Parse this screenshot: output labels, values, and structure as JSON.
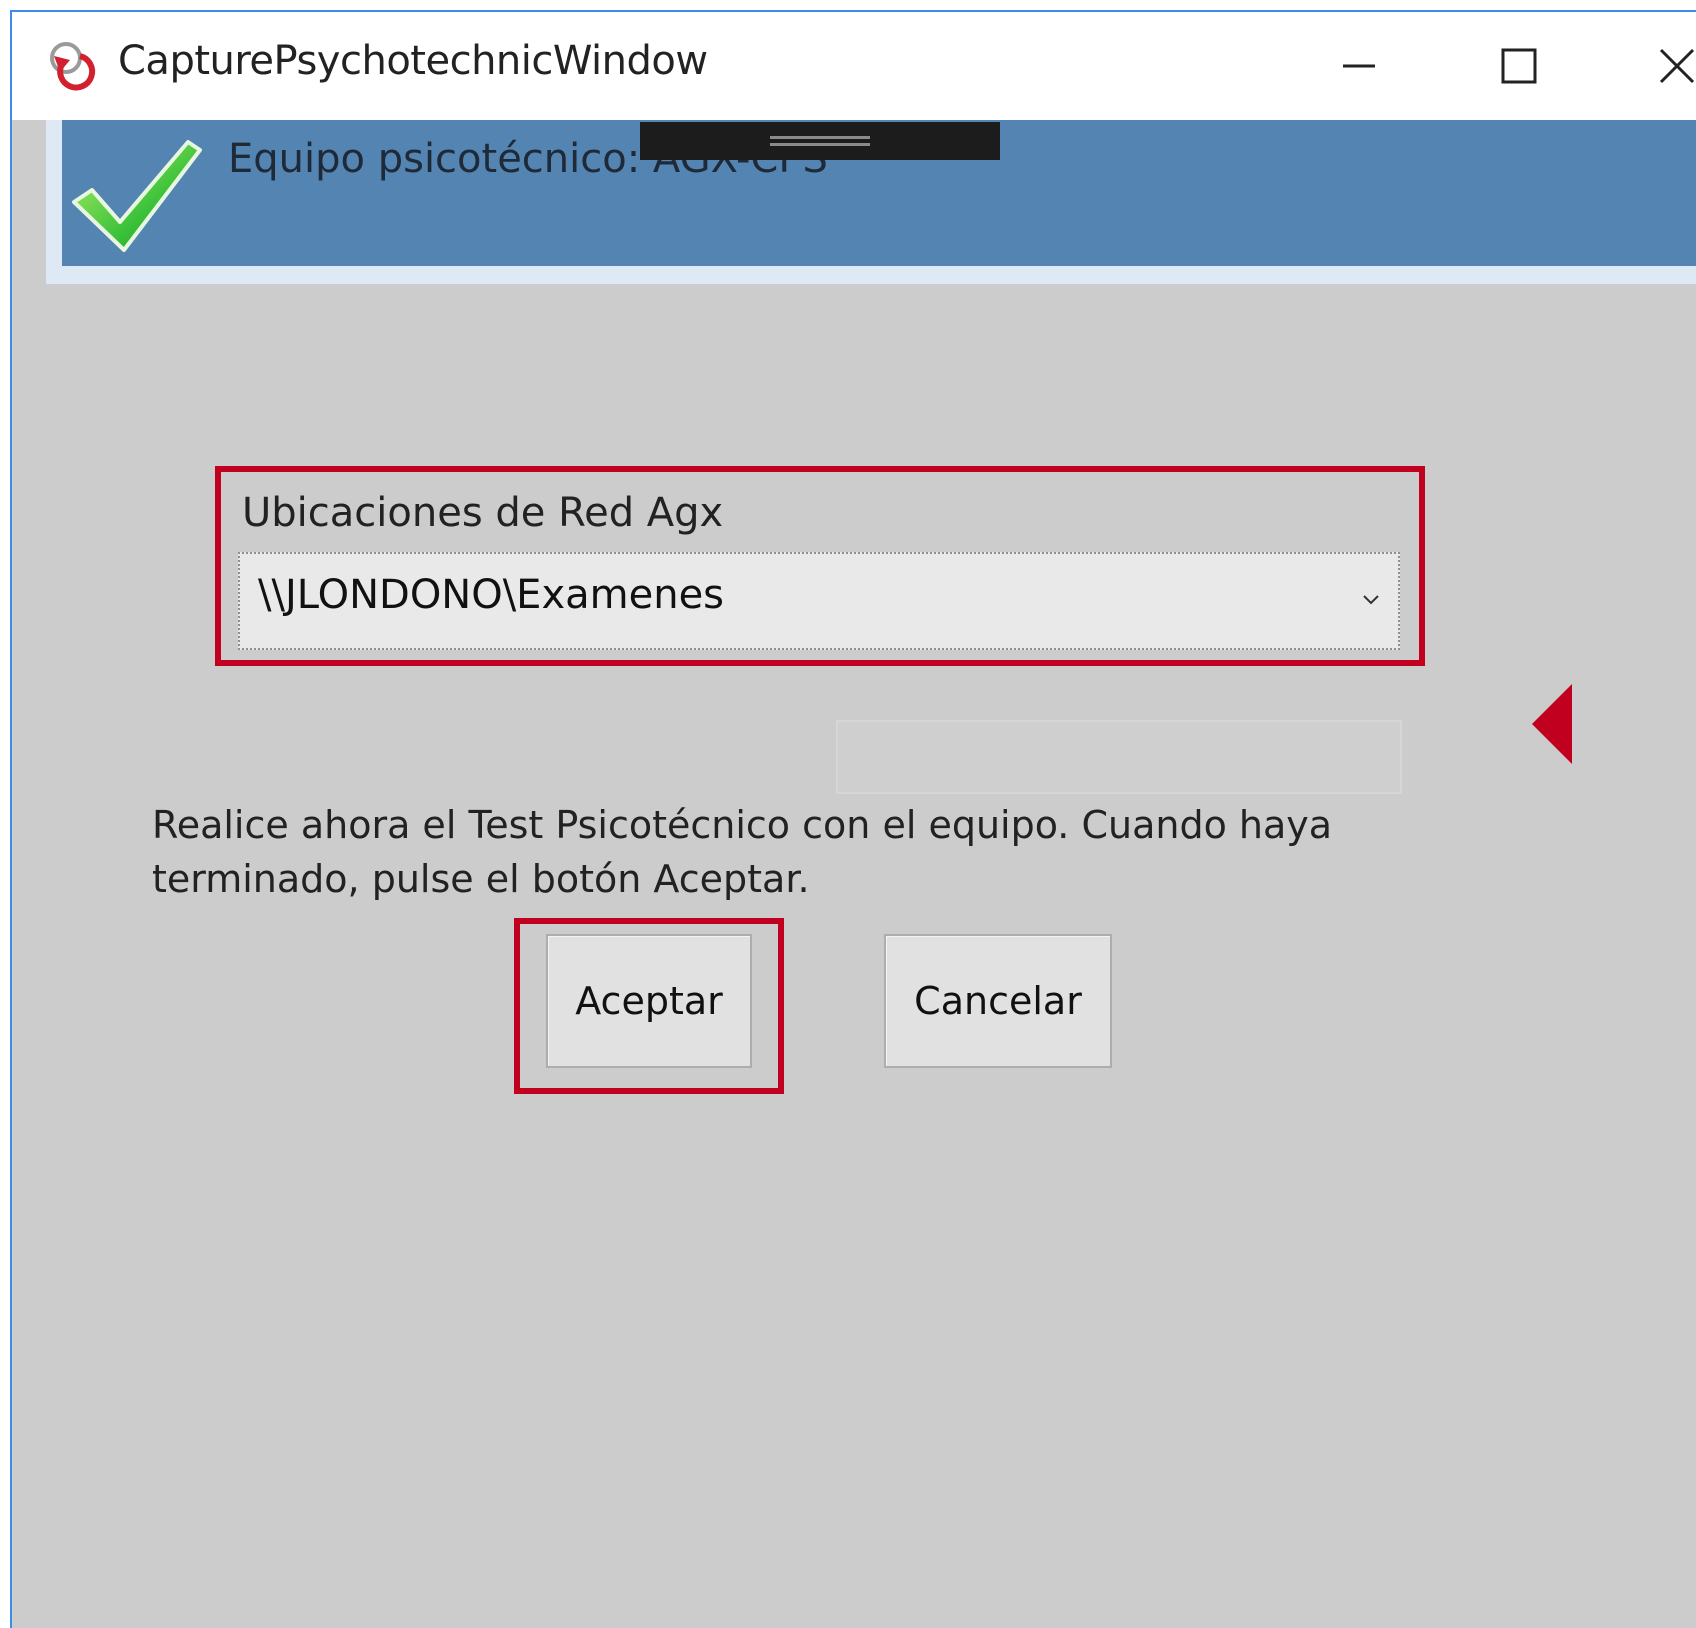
{
  "window": {
    "title": "CapturePsychotechnicWindow",
    "app_icon": "refresh-arrow-icon",
    "controls": {
      "minimize_icon": "minimize-icon",
      "maximize_icon": "maximize-icon",
      "close_icon": "close-icon"
    }
  },
  "banner": {
    "status_icon": "checkmark-icon",
    "text": "Equipo psicotécnico: AGX-CPS"
  },
  "network": {
    "label": "Ubicaciones de Red Agx",
    "selected_value": "\\\\JLONDONO\\Examenes",
    "dropdown_icon": "chevron-down-icon"
  },
  "instructions": "Realice ahora el Test Psicotécnico con el equipo. Cuando haya terminado, pulse el botón Aceptar.",
  "buttons": {
    "accept_label": "Aceptar",
    "cancel_label": "Cancelar"
  },
  "colors": {
    "window_background": "#cccccc",
    "banner_background": "#5384b2",
    "highlight_red": "#c0001e",
    "window_border": "#3a8ee6"
  }
}
